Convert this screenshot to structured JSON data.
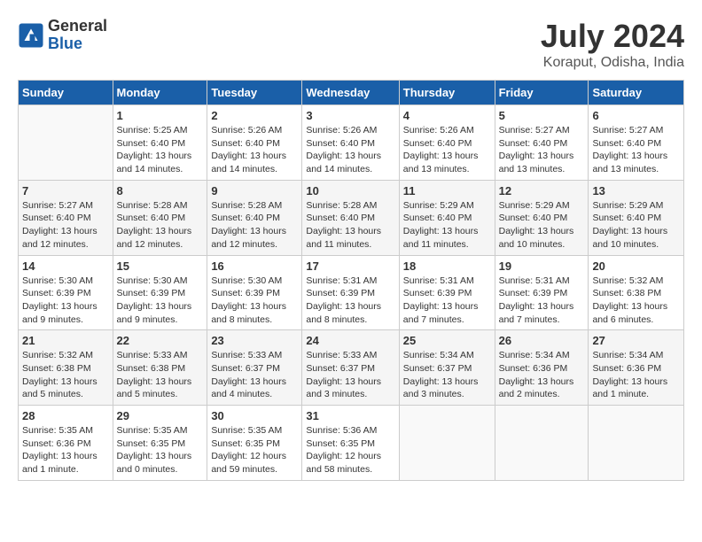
{
  "header": {
    "logo_general": "General",
    "logo_blue": "Blue",
    "month_title": "July 2024",
    "location": "Koraput, Odisha, India"
  },
  "columns": [
    "Sunday",
    "Monday",
    "Tuesday",
    "Wednesday",
    "Thursday",
    "Friday",
    "Saturday"
  ],
  "weeks": [
    [
      {
        "day": "",
        "info": ""
      },
      {
        "day": "1",
        "info": "Sunrise: 5:25 AM\nSunset: 6:40 PM\nDaylight: 13 hours\nand 14 minutes."
      },
      {
        "day": "2",
        "info": "Sunrise: 5:26 AM\nSunset: 6:40 PM\nDaylight: 13 hours\nand 14 minutes."
      },
      {
        "day": "3",
        "info": "Sunrise: 5:26 AM\nSunset: 6:40 PM\nDaylight: 13 hours\nand 14 minutes."
      },
      {
        "day": "4",
        "info": "Sunrise: 5:26 AM\nSunset: 6:40 PM\nDaylight: 13 hours\nand 13 minutes."
      },
      {
        "day": "5",
        "info": "Sunrise: 5:27 AM\nSunset: 6:40 PM\nDaylight: 13 hours\nand 13 minutes."
      },
      {
        "day": "6",
        "info": "Sunrise: 5:27 AM\nSunset: 6:40 PM\nDaylight: 13 hours\nand 13 minutes."
      }
    ],
    [
      {
        "day": "7",
        "info": "Sunrise: 5:27 AM\nSunset: 6:40 PM\nDaylight: 13 hours\nand 12 minutes."
      },
      {
        "day": "8",
        "info": "Sunrise: 5:28 AM\nSunset: 6:40 PM\nDaylight: 13 hours\nand 12 minutes."
      },
      {
        "day": "9",
        "info": "Sunrise: 5:28 AM\nSunset: 6:40 PM\nDaylight: 13 hours\nand 12 minutes."
      },
      {
        "day": "10",
        "info": "Sunrise: 5:28 AM\nSunset: 6:40 PM\nDaylight: 13 hours\nand 11 minutes."
      },
      {
        "day": "11",
        "info": "Sunrise: 5:29 AM\nSunset: 6:40 PM\nDaylight: 13 hours\nand 11 minutes."
      },
      {
        "day": "12",
        "info": "Sunrise: 5:29 AM\nSunset: 6:40 PM\nDaylight: 13 hours\nand 10 minutes."
      },
      {
        "day": "13",
        "info": "Sunrise: 5:29 AM\nSunset: 6:40 PM\nDaylight: 13 hours\nand 10 minutes."
      }
    ],
    [
      {
        "day": "14",
        "info": "Sunrise: 5:30 AM\nSunset: 6:39 PM\nDaylight: 13 hours\nand 9 minutes."
      },
      {
        "day": "15",
        "info": "Sunrise: 5:30 AM\nSunset: 6:39 PM\nDaylight: 13 hours\nand 9 minutes."
      },
      {
        "day": "16",
        "info": "Sunrise: 5:30 AM\nSunset: 6:39 PM\nDaylight: 13 hours\nand 8 minutes."
      },
      {
        "day": "17",
        "info": "Sunrise: 5:31 AM\nSunset: 6:39 PM\nDaylight: 13 hours\nand 8 minutes."
      },
      {
        "day": "18",
        "info": "Sunrise: 5:31 AM\nSunset: 6:39 PM\nDaylight: 13 hours\nand 7 minutes."
      },
      {
        "day": "19",
        "info": "Sunrise: 5:31 AM\nSunset: 6:39 PM\nDaylight: 13 hours\nand 7 minutes."
      },
      {
        "day": "20",
        "info": "Sunrise: 5:32 AM\nSunset: 6:38 PM\nDaylight: 13 hours\nand 6 minutes."
      }
    ],
    [
      {
        "day": "21",
        "info": "Sunrise: 5:32 AM\nSunset: 6:38 PM\nDaylight: 13 hours\nand 5 minutes."
      },
      {
        "day": "22",
        "info": "Sunrise: 5:33 AM\nSunset: 6:38 PM\nDaylight: 13 hours\nand 5 minutes."
      },
      {
        "day": "23",
        "info": "Sunrise: 5:33 AM\nSunset: 6:37 PM\nDaylight: 13 hours\nand 4 minutes."
      },
      {
        "day": "24",
        "info": "Sunrise: 5:33 AM\nSunset: 6:37 PM\nDaylight: 13 hours\nand 3 minutes."
      },
      {
        "day": "25",
        "info": "Sunrise: 5:34 AM\nSunset: 6:37 PM\nDaylight: 13 hours\nand 3 minutes."
      },
      {
        "day": "26",
        "info": "Sunrise: 5:34 AM\nSunset: 6:36 PM\nDaylight: 13 hours\nand 2 minutes."
      },
      {
        "day": "27",
        "info": "Sunrise: 5:34 AM\nSunset: 6:36 PM\nDaylight: 13 hours\nand 1 minute."
      }
    ],
    [
      {
        "day": "28",
        "info": "Sunrise: 5:35 AM\nSunset: 6:36 PM\nDaylight: 13 hours\nand 1 minute."
      },
      {
        "day": "29",
        "info": "Sunrise: 5:35 AM\nSunset: 6:35 PM\nDaylight: 13 hours\nand 0 minutes."
      },
      {
        "day": "30",
        "info": "Sunrise: 5:35 AM\nSunset: 6:35 PM\nDaylight: 12 hours\nand 59 minutes."
      },
      {
        "day": "31",
        "info": "Sunrise: 5:36 AM\nSunset: 6:35 PM\nDaylight: 12 hours\nand 58 minutes."
      },
      {
        "day": "",
        "info": ""
      },
      {
        "day": "",
        "info": ""
      },
      {
        "day": "",
        "info": ""
      }
    ]
  ]
}
